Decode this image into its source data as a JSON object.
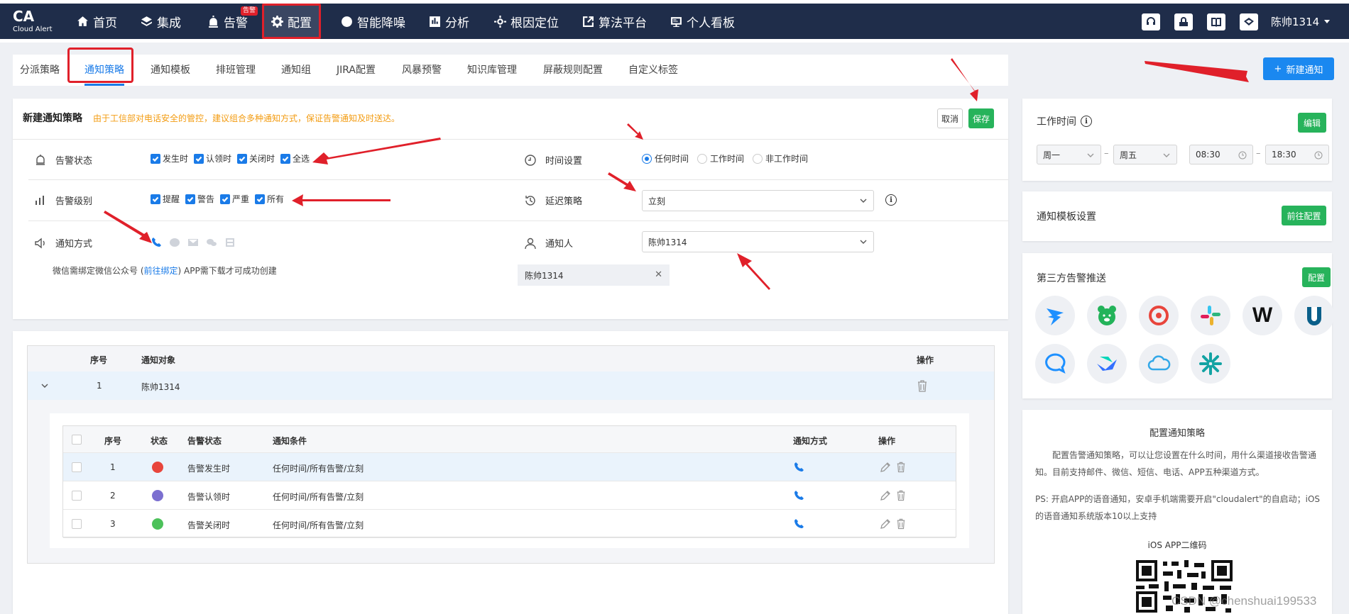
{
  "brand": {
    "logo": "CA",
    "name": "Cloud Alert"
  },
  "nav": [
    {
      "label": "首页",
      "icon": "home-icon"
    },
    {
      "label": "集成",
      "icon": "layers-icon"
    },
    {
      "label": "告警",
      "icon": "alarm-icon",
      "badge": "告警"
    },
    {
      "label": "配置",
      "icon": "gear-icon",
      "active": true
    },
    {
      "label": "智能降噪",
      "icon": "noise-icon"
    },
    {
      "label": "分析",
      "icon": "chart-icon"
    },
    {
      "label": "根因定位",
      "icon": "target-icon"
    },
    {
      "label": "算法平台",
      "icon": "algorithm-icon"
    },
    {
      "label": "个人看板",
      "icon": "dashboard-icon"
    }
  ],
  "user": {
    "name": "陈帅1314"
  },
  "tabs": [
    "分派策略",
    "通知策略",
    "通知模板",
    "排班管理",
    "通知组",
    "JIRA配置",
    "风暴预警",
    "知识库管理",
    "屏蔽规则配置",
    "自定义标签"
  ],
  "active_tab": "通知策略",
  "new_button": "新建通知",
  "form": {
    "title": "新建通知策略",
    "note": "由于工信部对电话安全的管控，建议组合多种通知方式，保证告警通知及时送达。",
    "cancel": "取消",
    "save": "保存",
    "alert_status": {
      "label": "告警状态",
      "options": [
        "发生时",
        "认领时",
        "关闭时",
        "全选"
      ]
    },
    "alert_level": {
      "label": "告警级别",
      "options": [
        "提醒",
        "警告",
        "严重",
        "所有"
      ]
    },
    "notify_method": {
      "label": "通知方式"
    },
    "hint_pre": "微信需绑定微信公众号 (",
    "hint_link": "前往绑定",
    "hint_post": ") APP需下载才可成功创建",
    "time_setting": {
      "label": "时间设置",
      "options": [
        "任何时间",
        "工作时间",
        "非工作时间"
      ],
      "selected": "任何时间"
    },
    "delay": {
      "label": "延迟策略",
      "value": "立刻"
    },
    "notifier": {
      "label": "通知人",
      "value": "陈帅1314",
      "tag": "陈帅1314"
    }
  },
  "table": {
    "headers": [
      "序号",
      "通知对象",
      "操作"
    ],
    "row": {
      "index": "1",
      "target": "陈帅1314"
    },
    "inner_headers": [
      "序号",
      "状态",
      "告警状态",
      "通知条件",
      "通知方式",
      "操作"
    ],
    "inner_rows": [
      {
        "index": "1",
        "color": "#e8453c",
        "status": "告警发生时",
        "condition": "任何时间/所有告警/立刻"
      },
      {
        "index": "2",
        "color": "#7b6fd0",
        "status": "告警认领时",
        "condition": "任何时间/所有告警/立刻"
      },
      {
        "index": "3",
        "color": "#4cc15a",
        "status": "告警关闭时",
        "condition": "任何时间/所有告警/立刻"
      }
    ]
  },
  "work_time": {
    "title": "工作时间",
    "edit": "编辑",
    "day_from": "周一",
    "day_to": "周五",
    "time_from": "08:30",
    "time_to": "18:30"
  },
  "template_settings": {
    "title": "通知模板设置",
    "button": "前往配置"
  },
  "third_party": {
    "title": "第三方告警推送",
    "button": "配置"
  },
  "config_info": {
    "title": "配置通知策略",
    "desc": "配置告警通知策略，可以让您设置在什么时间，用什么渠道接收告警通知。目前支持邮件、微信、短信、电话、APP五种渠道方式。",
    "ps": "PS: 开启APP的语音通知，安卓手机端需要开启\"cloudalert\"的自启动；iOS的语音通知系统版本10以上支持",
    "qr_title": "iOS APP二维码"
  },
  "watermark": "CSDN @chenshuai199533"
}
